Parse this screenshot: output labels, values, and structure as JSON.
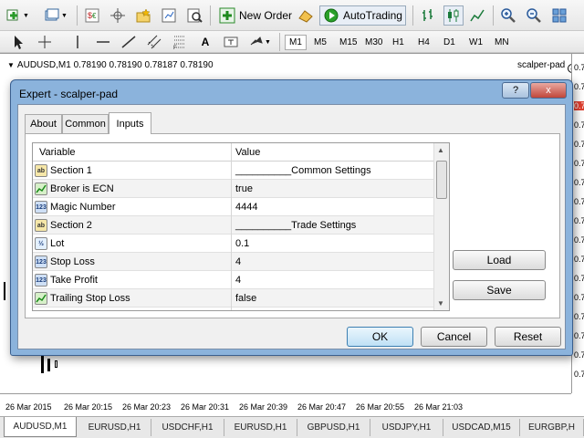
{
  "toolbar_main": {
    "new_order_label": "New Order",
    "autotrading_label": "AutoTrading",
    "icons": [
      "new-chart-icon",
      "profiles-icon",
      "market-watch-icon",
      "navigator-icon",
      "favorites-icon",
      "data-window-icon",
      "strategy-tester-icon",
      "metaeditor-icon",
      "bar-chart-icon",
      "candlestick-icon",
      "line-chart-icon",
      "zoom-in-icon",
      "zoom-out-icon",
      "tile-windows-icon"
    ]
  },
  "toolbar_draw": {
    "tools": [
      "cursor-icon",
      "crosshair-icon",
      "vertical-line-icon",
      "horizontal-line-icon",
      "trendline-icon",
      "equidistant-channel-icon",
      "fibonacci-icon",
      "text-icon",
      "text-label-icon",
      "arrows-icon"
    ],
    "periods": [
      "M1",
      "M5",
      "M15",
      "M30",
      "H1",
      "H4",
      "D1",
      "W1",
      "MN"
    ],
    "active_period": "M1"
  },
  "chart": {
    "info": "AUDUSD,M1  0.78190 0.78190 0.78187 0.78190",
    "ea_label": "scalper-pad",
    "price_labels": [
      "0.7",
      "0.7",
      "0.7",
      "0.7",
      "0.7",
      "0.7",
      "0.7",
      "0.7",
      "0.7",
      "0.7",
      "0.7",
      "0.7",
      "0.7",
      "0.7",
      "0.7",
      "0.7",
      "0.7"
    ],
    "time_labels": [
      "26 Mar 2015",
      "26 Mar 20:15",
      "26 Mar 20:23",
      "26 Mar 20:31",
      "26 Mar 20:39",
      "26 Mar 20:47",
      "26 Mar 20:55",
      "26 Mar 21:03"
    ]
  },
  "chart_tabs": [
    "AUDUSD,M1",
    "EURUSD,H1",
    "USDCHF,H1",
    "EURUSD,H1",
    "GBPUSD,H1",
    "USDJPY,H1",
    "USDCAD,M15",
    "EURGBP,H"
  ],
  "dialog": {
    "title": "Expert - scalper-pad",
    "window_buttons": [
      "?",
      "x"
    ],
    "tabs": [
      "About",
      "Common",
      "Inputs"
    ],
    "active_tab": "Inputs",
    "columns": [
      "Variable",
      "Value"
    ],
    "rows": [
      {
        "type": "string",
        "icon": "ab",
        "name": "Section 1",
        "value": "__________Common Settings"
      },
      {
        "type": "bool",
        "icon": "bool",
        "name": "Broker is ECN",
        "value": "true"
      },
      {
        "type": "int",
        "icon": "123",
        "name": "Magic Number",
        "value": "4444"
      },
      {
        "type": "string",
        "icon": "ab",
        "name": "Section 2",
        "value": "__________Trade Settings"
      },
      {
        "type": "double",
        "icon": "½",
        "name": "Lot",
        "value": "0.1"
      },
      {
        "type": "int",
        "icon": "123",
        "name": "Stop Loss",
        "value": "4"
      },
      {
        "type": "int",
        "icon": "123",
        "name": "Take Profit",
        "value": "4"
      },
      {
        "type": "bool",
        "icon": "bool",
        "name": "Trailing Stop Loss",
        "value": "false"
      }
    ],
    "side_buttons": {
      "load": "Load",
      "save": "Save"
    },
    "footer_buttons": {
      "ok": "OK",
      "cancel": "Cancel",
      "reset": "Reset"
    }
  }
}
